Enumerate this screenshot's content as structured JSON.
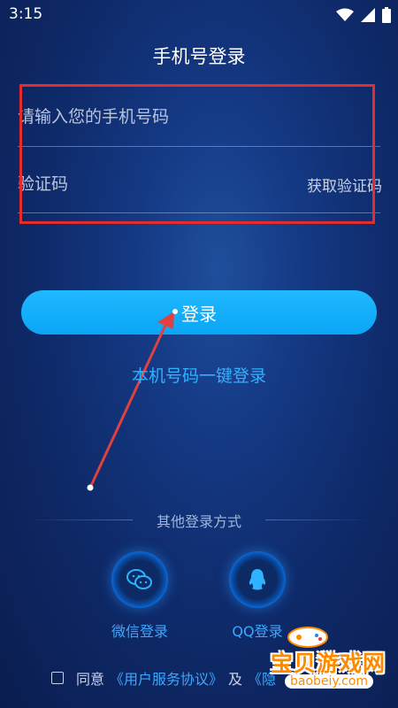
{
  "status": {
    "time": "3:15"
  },
  "page": {
    "title": "手机号登录"
  },
  "form": {
    "phone_placeholder": "请输入您的手机号码",
    "code_placeholder": "验证码",
    "get_code_label": "获取验证码"
  },
  "actions": {
    "login_label": "登录",
    "onekey_label": "本机号码一键登录"
  },
  "other": {
    "title": "其他登录方式",
    "wechat_label": "微信登录",
    "qq_label": "QQ登录"
  },
  "agreement": {
    "prefix": "同意",
    "user_agreement": "《用户服务协议》",
    "and": "及",
    "privacy": "《隐"
  },
  "watermark": {
    "text": "宝贝游戏网",
    "url": "baobeiy.com"
  },
  "colors": {
    "accent": "#0aa6f5",
    "link": "#3ba8ff",
    "highlight_box": "#e32c2c",
    "annotation_arrow": "#e04040"
  }
}
